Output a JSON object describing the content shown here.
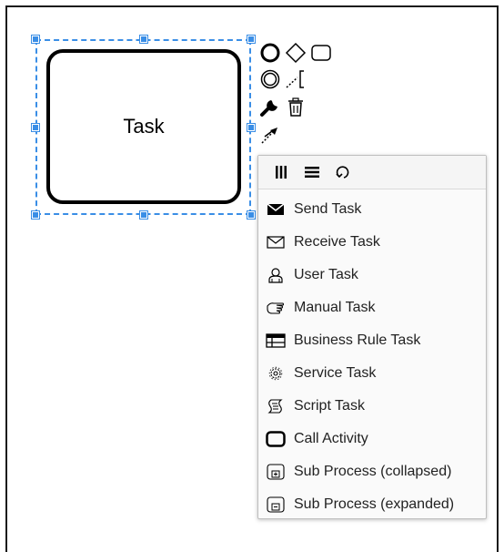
{
  "canvas": {
    "task_label": "Task"
  },
  "context_pad": {
    "entries": [
      {
        "icon": "start-event-icon"
      },
      {
        "icon": "gateway-icon"
      },
      {
        "icon": "task-icon"
      },
      {
        "icon": "intermediate-event-icon"
      },
      {
        "icon": "text-annotation-icon"
      },
      {
        "icon": "wrench-icon"
      },
      {
        "icon": "trash-icon"
      },
      {
        "icon": "connect-arrow-icon"
      }
    ]
  },
  "popup_menu": {
    "header_entries": [
      {
        "icon": "parallel-multi-instance-icon"
      },
      {
        "icon": "sequential-multi-instance-icon"
      },
      {
        "icon": "loop-icon"
      }
    ],
    "items": [
      {
        "label": "Send Task",
        "icon": "send-task-icon"
      },
      {
        "label": "Receive Task",
        "icon": "receive-task-icon"
      },
      {
        "label": "User Task",
        "icon": "user-task-icon"
      },
      {
        "label": "Manual Task",
        "icon": "manual-task-icon"
      },
      {
        "label": "Business Rule Task",
        "icon": "business-rule-task-icon"
      },
      {
        "label": "Service Task",
        "icon": "service-task-icon"
      },
      {
        "label": "Script Task",
        "icon": "script-task-icon"
      },
      {
        "label": "Call Activity",
        "icon": "call-activity-icon"
      },
      {
        "label": "Sub Process (collapsed)",
        "icon": "subprocess-collapsed-icon"
      },
      {
        "label": "Sub Process (expanded)",
        "icon": "subprocess-expanded-icon"
      }
    ]
  },
  "colors": {
    "selection": "#3a8ee6",
    "menu_background": "#fafafa",
    "stroke": "#000000"
  }
}
